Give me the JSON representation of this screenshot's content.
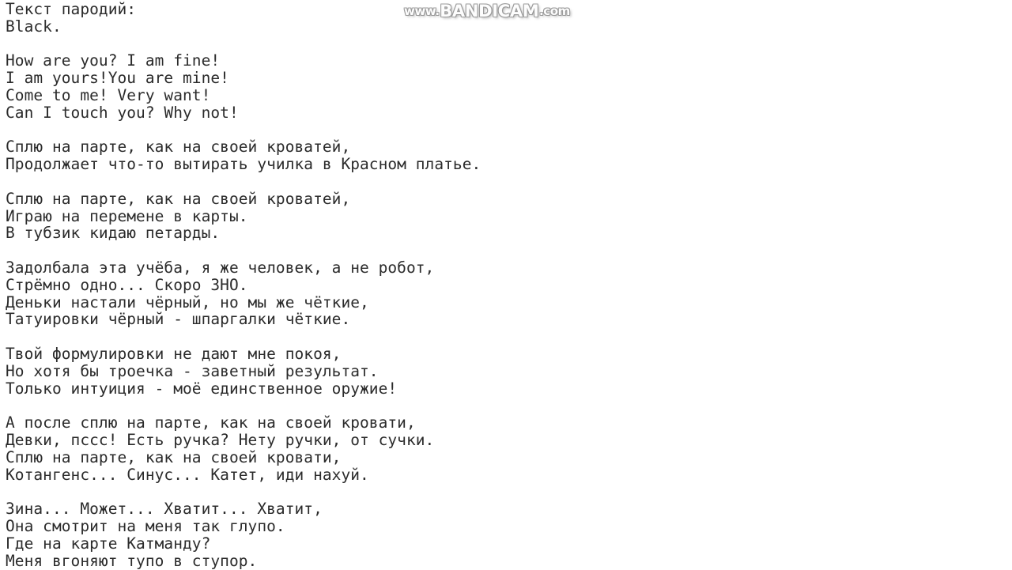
{
  "document": {
    "title": "Текст пародий",
    "background_color": "#ffffff",
    "text_color": "#2b2b2b",
    "font_kind": "monospace"
  },
  "watermark": {
    "name": "bandicam-watermark",
    "prefix": "www.",
    "brand": "BANDICAM",
    "suffix": ".com",
    "full_text": "www.BANDICAM.com",
    "color": "#fdfdfd",
    "outline_color": "#9a9a9a"
  },
  "lyrics": {
    "lines": [
      "Текст пародий:",
      "Black.",
      "",
      "How are you? I am fine!",
      "I am yours!You are mine!",
      "Come to me! Very want!",
      "Can I touch you? Why not!",
      "",
      "Сплю на парте, как на своей кроватей,",
      "Продолжает что-то вытирать училка в Красном платье.",
      "",
      "Сплю на парте, как на своей кроватей,",
      "Играю на перемене в карты.",
      "В тубзик кидаю петарды.",
      "",
      "Задолбала эта учёба, я же человек, а не робот,",
      "Стрёмно одно... Скоро ЗНО.",
      "Деньки настали чёрный, но мы же чёткие,",
      "Татуировки чёрный - шпаргалки чёткие.",
      "",
      "Твой формулировки не дают мне покоя,",
      "Но хотя бы троечка - заветный результат.",
      "Только интуиция - моё единственное оружие!",
      "",
      "А после сплю на парте, как на своей кровати,",
      "Девки, пссс! Есть ручка? Нету ручки, от сучки.",
      "Сплю на парте, как на своей кровати,",
      "Котангенс... Синус... Катет, иди нахуй.",
      "",
      "Зина... Может... Хватит... Хватит,",
      "Она смотрит на меня так глупо.",
      "Где на карте Катманду?",
      "Меня вгоняют тупо в ступор."
    ]
  }
}
